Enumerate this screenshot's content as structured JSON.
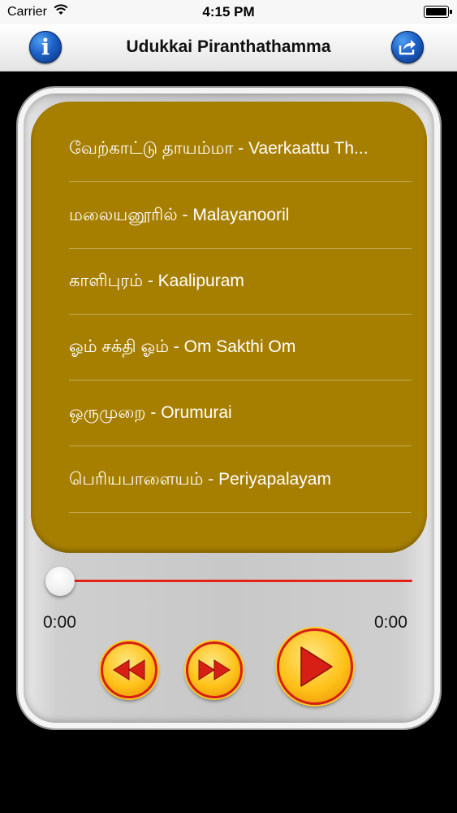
{
  "status_bar": {
    "carrier": "Carrier",
    "time": "4:15 PM"
  },
  "nav": {
    "title": "Udukkai Piranthathamma",
    "info_icon": "info-icon",
    "share_icon": "share-icon"
  },
  "songs": [
    {
      "label": "வேற்காட்டு தாயம்மா - Vaerkaattu Th..."
    },
    {
      "label": "மலையனூரில் - Malayanooril"
    },
    {
      "label": "காளிபுரம் - Kaalipuram"
    },
    {
      "label": "ஓம் சக்தி   ஓம் - Om Sakthi Om"
    },
    {
      "label": "ஒருமுறை - Orumurai"
    },
    {
      "label": "பெரியபாளையம் - Periyapalayam"
    }
  ],
  "player": {
    "current_time": "0:00",
    "total_time": "0:00",
    "progress": 0,
    "controls": [
      "rewind-icon",
      "fast-forward-icon",
      "play-icon"
    ]
  },
  "colors": {
    "list_background": "#a77f00",
    "slider_track": "#e2231a",
    "control_fill": "#ffc21a",
    "control_ring": "#d71f16"
  }
}
